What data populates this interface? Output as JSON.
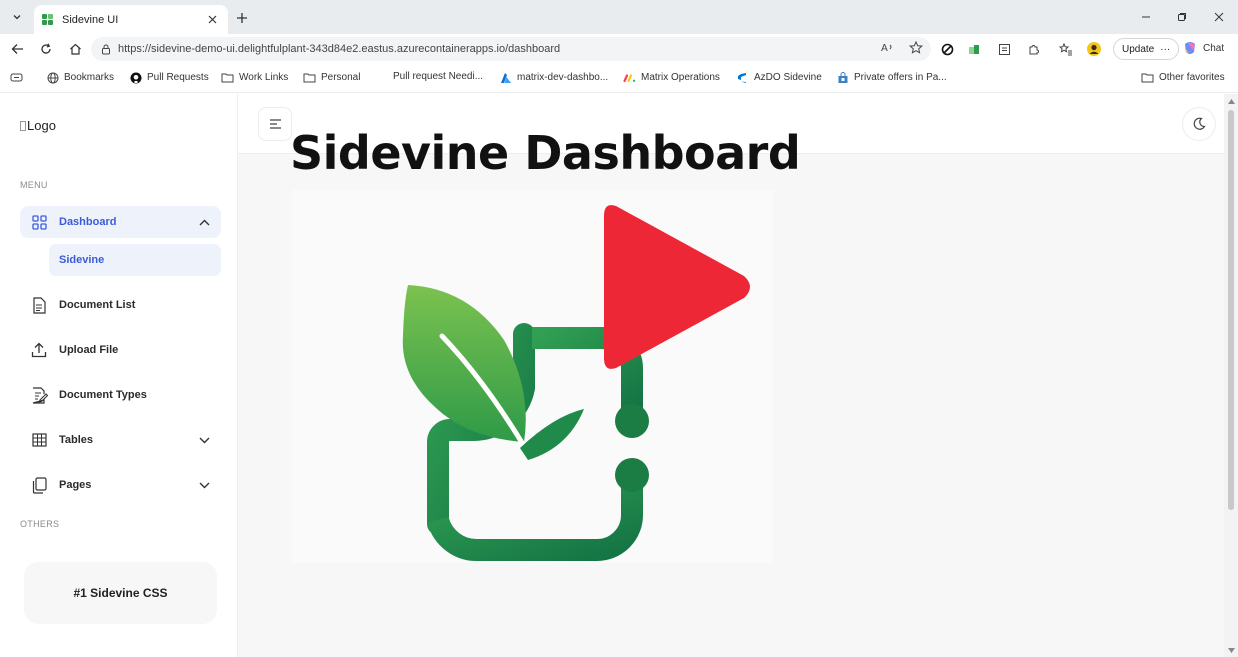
{
  "browser": {
    "tab_title": "Sidevine UI",
    "url": "https://sidevine-demo-ui.delightfulplant-343d84e2.eastus.azurecontainerapps.io/dashboard",
    "update_label": "Update",
    "update_more": "···",
    "chat_label": "Chat",
    "bookmarks": [
      {
        "label": "Bookmarks",
        "icon": "globe-icon"
      },
      {
        "label": "Pull Requests",
        "icon": "github-icon"
      },
      {
        "label": "Work Links",
        "icon": "folder-icon"
      },
      {
        "label": "Personal",
        "icon": "folder-icon"
      },
      {
        "label": "Pull request Needi...",
        "icon": "none"
      },
      {
        "label": "matrix-dev-dashbo...",
        "icon": "azure-icon"
      },
      {
        "label": "Matrix Operations",
        "icon": "monday-icon"
      },
      {
        "label": "AzDO Sidevine",
        "icon": "azure-devops-icon"
      },
      {
        "label": "Private offers in Pa...",
        "icon": "store-icon"
      }
    ],
    "other_favorites": "Other favorites"
  },
  "sidebar": {
    "logo_alt": "Logo",
    "menu_label": "MENU",
    "others_label": "OTHERS",
    "items": [
      {
        "label": "Dashboard",
        "icon": "grid-icon"
      },
      {
        "label": "Document List",
        "icon": "document-icon"
      },
      {
        "label": "Upload File",
        "icon": "upload-icon"
      },
      {
        "label": "Document Types",
        "icon": "edit-document-icon"
      },
      {
        "label": "Tables",
        "icon": "table-icon"
      },
      {
        "label": "Pages",
        "icon": "pages-icon"
      }
    ],
    "sub_item": "Sidevine",
    "promo": "#1 Sidevine CSS"
  },
  "main": {
    "title": "Sidevine Dashboard"
  },
  "colors": {
    "accent": "#3b5bdb",
    "active_bg": "#eef2fb",
    "play_red": "#ee2737",
    "leaf_green": "#4caf50",
    "leaf_dark": "#1b7a43"
  }
}
